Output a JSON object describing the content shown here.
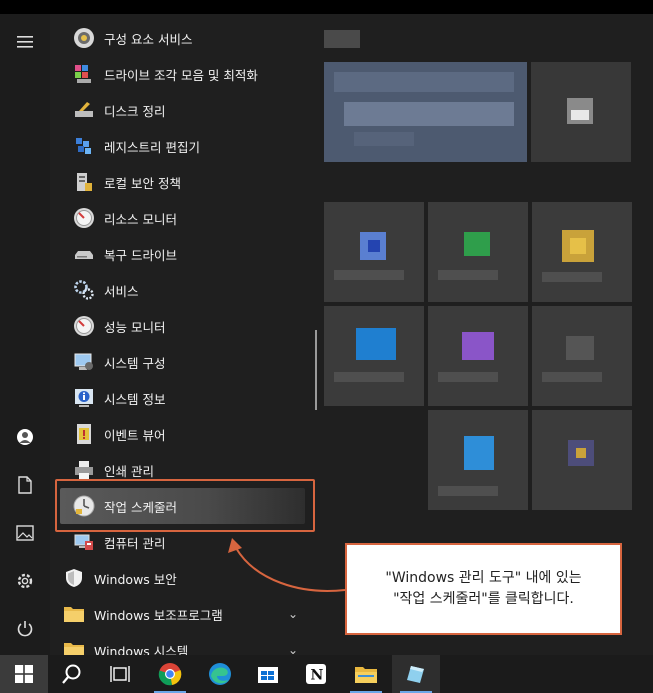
{
  "apps": [
    {
      "label": "구성 요소 서비스",
      "icon": "component-services-icon"
    },
    {
      "label": "드라이브 조각 모음 및 최적화",
      "icon": "defrag-icon"
    },
    {
      "label": "디스크 정리",
      "icon": "disk-cleanup-icon"
    },
    {
      "label": "레지스트리 편집기",
      "icon": "registry-editor-icon"
    },
    {
      "label": "로컬 보안 정책",
      "icon": "local-security-policy-icon"
    },
    {
      "label": "리소스 모니터",
      "icon": "resource-monitor-icon"
    },
    {
      "label": "복구 드라이브",
      "icon": "recovery-drive-icon"
    },
    {
      "label": "서비스",
      "icon": "services-icon"
    },
    {
      "label": "성능 모니터",
      "icon": "performance-monitor-icon"
    },
    {
      "label": "시스템 구성",
      "icon": "system-configuration-icon"
    },
    {
      "label": "시스템 정보",
      "icon": "system-information-icon"
    },
    {
      "label": "이벤트 뷰어",
      "icon": "event-viewer-icon"
    },
    {
      "label": "인쇄 관리",
      "icon": "print-management-icon"
    },
    {
      "label": "작업 스케줄러",
      "icon": "task-scheduler-icon"
    },
    {
      "label": "컴퓨터 관리",
      "icon": "computer-management-icon"
    }
  ],
  "folders": [
    {
      "label": "Windows 보안",
      "icon": "shield-icon"
    },
    {
      "label": "Windows 보조프로그램",
      "icon": "folder-icon"
    },
    {
      "label": "Windows 시스템",
      "icon": "folder-icon"
    }
  ],
  "callout": {
    "line1": "\"Windows 관리 도구\" 내에 있는",
    "line2": "\"작업 스케줄러\"를 클릭합니다."
  },
  "rail": [
    "hamburger-menu-icon",
    "user-icon",
    "document-icon",
    "pictures-icon",
    "settings-icon",
    "power-icon"
  ],
  "taskbar": [
    "windows-start-icon",
    "search-icon",
    "task-view-icon",
    "chrome-icon",
    "edge-icon",
    "store-icon",
    "notion-icon",
    "file-explorer-icon",
    "app-icon"
  ],
  "colors": {
    "accent": "#d7653f",
    "background": "#1f1f1f",
    "taskbar": "#1b1b1b"
  }
}
